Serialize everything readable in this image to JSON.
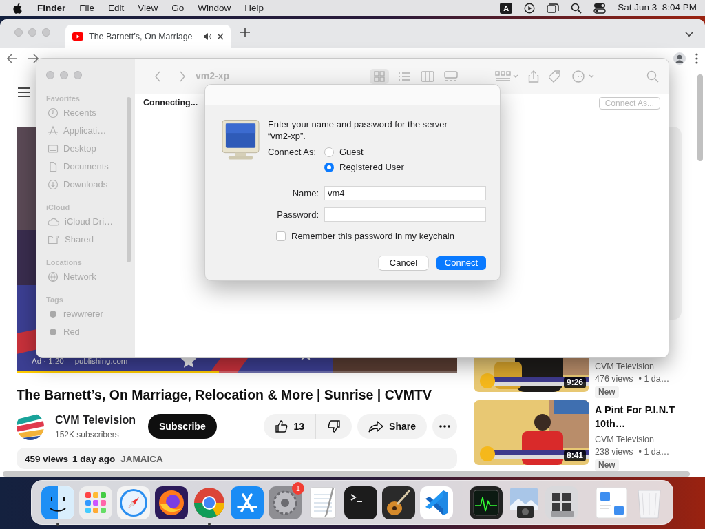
{
  "menubar": {
    "app": "Finder",
    "menus": [
      "File",
      "Edit",
      "View",
      "Go",
      "Window",
      "Help"
    ],
    "input_source": "A",
    "clock": "Sat Jun 3  8:04 PM"
  },
  "browser": {
    "tab": {
      "title": "The Barnett’s, On Marriage"
    },
    "page": {
      "video": {
        "ad_time": "Ad · 1:20",
        "ad_source": "publishing.com",
        "ad_progress": {
          "level": 0.46
        }
      },
      "title": "The Barnett’s, On Marriage, Relocation & More | Sunrise | CVMTV",
      "channel": {
        "name": "CVM Television",
        "subscribers": "152K subscribers"
      },
      "subscribe": "Subscribe",
      "likes": "13",
      "share": "Share",
      "description": {
        "views": "459 views",
        "date": "1 day ago",
        "tag": "JAMAICA"
      },
      "related": [
        {
          "channel": "CVM Television",
          "views": "476 views",
          "age": "• 1 da…",
          "badge": "New",
          "duration": "9:26"
        },
        {
          "title": "A Pint For P.I.N.T 10th…",
          "channel": "CVM Television",
          "views": "238 views",
          "age": "• 1 da…",
          "badge": "New",
          "duration": "8:41"
        }
      ]
    }
  },
  "finder": {
    "title": "vm2-xp",
    "status": "Connecting...",
    "connect_as": "Connect As...",
    "sidebar": [
      {
        "heading": "Favorites",
        "items": [
          {
            "label": "Recents",
            "kind": "recents"
          },
          {
            "label": "Applicati…",
            "kind": "applications"
          },
          {
            "label": "Desktop",
            "kind": "desktop"
          },
          {
            "label": "Documents",
            "kind": "documents"
          },
          {
            "label": "Downloads",
            "kind": "downloads"
          }
        ]
      },
      {
        "heading": "iCloud",
        "items": [
          {
            "label": "iCloud Dri…",
            "kind": "icloud"
          },
          {
            "label": "Shared",
            "kind": "shared"
          }
        ]
      },
      {
        "heading": "Locations",
        "items": [
          {
            "label": "Network",
            "kind": "network"
          }
        ]
      },
      {
        "heading": "Tags",
        "items": [
          {
            "label": "rewwrerer",
            "kind": "tag",
            "color": "#a9a9a9"
          },
          {
            "label": "Red",
            "kind": "tag",
            "color": "#a9a9a9"
          }
        ]
      }
    ]
  },
  "dialog": {
    "message": "Enter your name and password for the server “vm2-xp”.",
    "connect_as_label": "Connect As:",
    "options": [
      {
        "label": "Guest",
        "selected": false
      },
      {
        "label": "Registered User",
        "selected": true
      }
    ],
    "name_label": "Name:",
    "name_value": "vm4",
    "password_label": "Password:",
    "remember": {
      "label": "Remember this password in my keychain",
      "checked": false
    },
    "buttons": [
      {
        "label": "Cancel",
        "kind": "secondary"
      },
      {
        "label": "Connect",
        "kind": "primary"
      }
    ]
  },
  "dock": {
    "items": [
      {
        "kind": "finder",
        "running": true
      },
      {
        "kind": "launchpad",
        "running": false
      },
      {
        "kind": "safari",
        "running": false
      },
      {
        "kind": "firefox",
        "running": false
      },
      {
        "kind": "chrome",
        "running": true
      },
      {
        "kind": "appstore",
        "running": false
      },
      {
        "kind": "settings",
        "running": false,
        "badge": "1"
      },
      {
        "kind": "textedit",
        "running": false
      },
      {
        "kind": "terminal",
        "running": false
      },
      {
        "kind": "guitar",
        "running": false
      },
      {
        "kind": "code",
        "running": false
      },
      {
        "kind": "separator"
      },
      {
        "kind": "activity",
        "running": false
      },
      {
        "kind": "preview",
        "running": false
      },
      {
        "kind": "bootcamp",
        "running": false
      },
      {
        "kind": "separator"
      },
      {
        "kind": "window",
        "running": false
      },
      {
        "kind": "trash",
        "running": false
      }
    ]
  }
}
